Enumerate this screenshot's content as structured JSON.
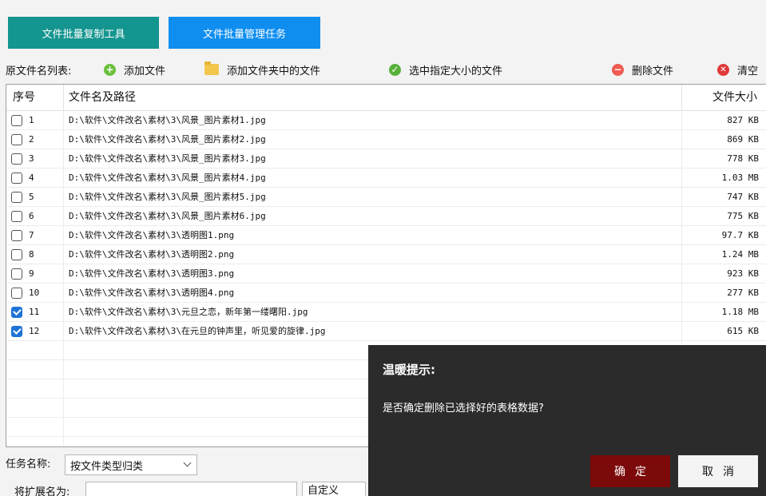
{
  "tabs": [
    {
      "label": "文件批量复制工具",
      "color": "#14958f"
    },
    {
      "label": "文件批量管理任务",
      "color": "#0f8ef0"
    }
  ],
  "toolbar": {
    "list_label": "原文件名列表:",
    "add_file": "添加文件",
    "add_folder": "添加文件夹中的文件",
    "select_size": "选中指定大小的文件",
    "delete_file": "删除文件",
    "clear": "清空"
  },
  "table": {
    "headers": {
      "no": "序号",
      "path": "文件名及路径",
      "size": "文件大小"
    },
    "rows": [
      {
        "no": "1",
        "path": "D:\\软件\\文件改名\\素材\\3\\风景_图片素材1.jpg",
        "size": "827 KB",
        "checked": false
      },
      {
        "no": "2",
        "path": "D:\\软件\\文件改名\\素材\\3\\风景_图片素材2.jpg",
        "size": "869 KB",
        "checked": false
      },
      {
        "no": "3",
        "path": "D:\\软件\\文件改名\\素材\\3\\风景_图片素材3.jpg",
        "size": "778 KB",
        "checked": false
      },
      {
        "no": "4",
        "path": "D:\\软件\\文件改名\\素材\\3\\风景_图片素材4.jpg",
        "size": "1.03 MB",
        "checked": false
      },
      {
        "no": "5",
        "path": "D:\\软件\\文件改名\\素材\\3\\风景_图片素材5.jpg",
        "size": "747 KB",
        "checked": false
      },
      {
        "no": "6",
        "path": "D:\\软件\\文件改名\\素材\\3\\风景_图片素材6.jpg",
        "size": "775 KB",
        "checked": false
      },
      {
        "no": "7",
        "path": "D:\\软件\\文件改名\\素材\\3\\透明图1.png",
        "size": "97.7 KB",
        "checked": false
      },
      {
        "no": "8",
        "path": "D:\\软件\\文件改名\\素材\\3\\透明图2.png",
        "size": "1.24 MB",
        "checked": false
      },
      {
        "no": "9",
        "path": "D:\\软件\\文件改名\\素材\\3\\透明图3.png",
        "size": "923 KB",
        "checked": false
      },
      {
        "no": "10",
        "path": "D:\\软件\\文件改名\\素材\\3\\透明图4.png",
        "size": "277 KB",
        "checked": false
      },
      {
        "no": "11",
        "path": "D:\\软件\\文件改名\\素材\\3\\元旦之恋，新年第一缕曙阳.jpg",
        "size": "1.18 MB",
        "checked": true
      },
      {
        "no": "12",
        "path": "D:\\软件\\文件改名\\素材\\3\\在元旦的钟声里，听见爱的旋律.jpg",
        "size": "615 KB",
        "checked": true
      }
    ]
  },
  "task": {
    "label": "任务名称:",
    "selected": "按文件类型归类"
  },
  "ext": {
    "label": "将扩展名为:",
    "value": "",
    "mode": "自定义"
  },
  "dialog": {
    "title": "温暖提示:",
    "message": "是否确定删除已选择好的表格数据?",
    "ok": "确定",
    "cancel": "取消"
  },
  "icons": {
    "add_file": "plus-circle-icon",
    "add_folder": "folder-icon",
    "select_size": "check-circle-icon",
    "delete_file": "minus-circle-icon",
    "clear": "close-circle-icon"
  }
}
